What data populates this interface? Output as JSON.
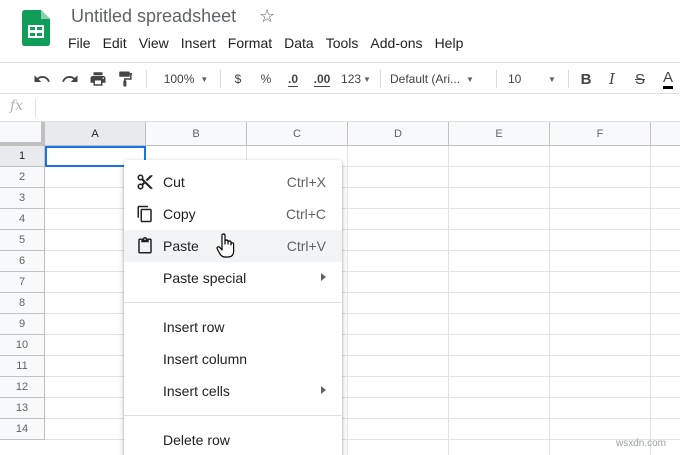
{
  "app": {
    "title": "Untitled spreadsheet",
    "brand_color": "#0f9d58"
  },
  "menu": [
    "File",
    "Edit",
    "View",
    "Insert",
    "Format",
    "Data",
    "Tools",
    "Add-ons",
    "Help"
  ],
  "toolbar": {
    "zoom": "100%",
    "currency": "$",
    "percent": "%",
    "decrease_decimals": ".0",
    "increase_decimals": ".00",
    "more_formats": "123",
    "font": "Default (Ari...",
    "font_size": "10",
    "bold": "B",
    "italic": "I",
    "strikethrough": "S",
    "text_color": "A"
  },
  "formula_bar": {
    "fx": "fx",
    "value": ""
  },
  "grid": {
    "columns": [
      "A",
      "B",
      "C",
      "D",
      "E",
      "F"
    ],
    "rows": [
      "1",
      "2",
      "3",
      "4",
      "5",
      "6",
      "7",
      "8",
      "9",
      "10",
      "11",
      "12",
      "13",
      "14"
    ],
    "active_cell": "A1",
    "selection_color": "#1a73e8"
  },
  "context_menu": {
    "items": [
      {
        "label": "Cut",
        "shortcut": "Ctrl+X",
        "icon": "scissors-icon"
      },
      {
        "label": "Copy",
        "shortcut": "Ctrl+C",
        "icon": "copy-icon"
      },
      {
        "label": "Paste",
        "shortcut": "Ctrl+V",
        "icon": "clipboard-icon",
        "hovered": true
      },
      {
        "label": "Paste special",
        "submenu": true
      }
    ],
    "insert_items": [
      {
        "label": "Insert row"
      },
      {
        "label": "Insert column"
      },
      {
        "label": "Insert cells",
        "submenu": true
      }
    ],
    "delete_items": [
      {
        "label": "Delete row"
      }
    ]
  },
  "watermark": "wsxdn.com"
}
